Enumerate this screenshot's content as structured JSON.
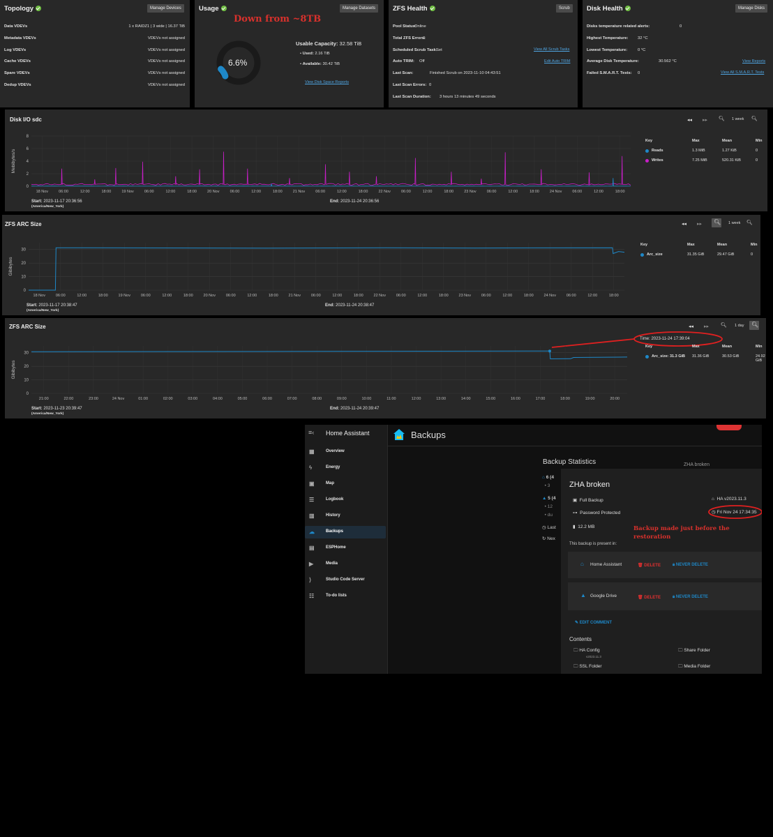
{
  "topology": {
    "title": "Topology",
    "button": "Manage Devices",
    "rows": [
      {
        "label": "Data VDEVs",
        "value": "1 x RAIDZ1 | 3 wide | 16.37 TiB"
      },
      {
        "label": "Metadata VDEVs",
        "value": "VDEVs not assigned"
      },
      {
        "label": "Log VDEVs",
        "value": "VDEVs not assigned"
      },
      {
        "label": "Cache VDEVs",
        "value": "VDEVs not assigned"
      },
      {
        "label": "Spare VDEVs",
        "value": "VDEVs not assigned"
      },
      {
        "label": "Dedup VDEVs",
        "value": "VDEVs not assigned"
      }
    ]
  },
  "usage": {
    "title": "Usage",
    "button": "Manage Datasets",
    "annotation": "Down from ~8TB",
    "percent_text": "6.6%",
    "percent": 0.066,
    "capacity_label": "Usable Capacity:",
    "capacity_value": "32.58 TiB",
    "used_label": "Used:",
    "used_value": "2.16 TiB",
    "available_label": "Available:",
    "available_value": "30.42 TiB",
    "link": "View Disk Space Reports"
  },
  "zfs_health": {
    "title": "ZFS Health",
    "button": "Scrub",
    "rows": [
      {
        "label": "Pool Status:",
        "value": "Online"
      },
      {
        "label": "Total ZFS Errors:",
        "value": "0"
      },
      {
        "label": "Scheduled Scrub Task:",
        "value": "Set"
      },
      {
        "label": "Auto TRIM:",
        "value": "Off"
      },
      {
        "label": "Last Scan:",
        "value": "Finished Scrub on 2023-11-10 04:43:51"
      },
      {
        "label": "Last Scan Errors:",
        "value": "0"
      },
      {
        "label": "Last Scan Duration:",
        "value": "3 hours 13 minutes 49 seconds"
      }
    ],
    "link_scrub": "View All Scrub Tasks",
    "link_trim": "Edit Auto TRIM"
  },
  "disk_health": {
    "title": "Disk Health",
    "button": "Manage Disks",
    "rows": [
      {
        "label": "Disks temperature related alerts:",
        "value": "0"
      },
      {
        "label": "Highest Temperature:",
        "value": "32 °C"
      },
      {
        "label": "Lowest Temperature:",
        "value": "0 °C"
      },
      {
        "label": "Average Disk Temperature:",
        "value": "30.562 °C"
      },
      {
        "label": "Failed S.M.A.R.T. Tests:",
        "value": "0"
      }
    ],
    "link_reports": "View Reports",
    "link_smart": "View All S.M.A.R.T. Tests"
  },
  "charts_ui": {
    "legend_key": "Key",
    "legend_max": "Max",
    "legend_mean": "Mean",
    "legend_min": "Min",
    "start_label": "Start:",
    "end_label": "End:",
    "tz": "(America/New_York)"
  },
  "disk_io": {
    "title": "Disk I/O sdc",
    "range": "1 week",
    "start": "2023-11-17 20:36:56",
    "end": "2023-11-24 20:36:56",
    "legend": [
      {
        "name": "Reads",
        "max": "1.3 MiB",
        "mean": "1.27 KiB",
        "min": "0",
        "color": "#1e88c8"
      },
      {
        "name": "Writes",
        "max": "7.25 MiB",
        "mean": "520.31 KiB",
        "min": "0",
        "color": "#c81ec8"
      }
    ]
  },
  "arc_week": {
    "title": "ZFS ARC Size",
    "range": "1 week",
    "start": "2023-11-17 20:38:47",
    "end": "2023-11-24 20:38:47",
    "legend": [
      {
        "name": "Arc_size",
        "max": "31.35 GiB",
        "mean": "29.47 GiB",
        "min": "0",
        "color": "#1e88c8"
      }
    ]
  },
  "arc_day": {
    "title": "ZFS ARC Size",
    "range": "1 day",
    "tooltip": "Time: 2023-11-24 17:39:04",
    "start": "2023-11-23 20:39:47",
    "end": "2023-11-24 20:39:47",
    "legend": [
      {
        "name": "Arc_size: 31.3 GiB",
        "max": "31.36 GiB",
        "mean": "30.53 GiB",
        "min": "24.92 GiB",
        "color": "#1e88c8"
      }
    ]
  },
  "chart_data": [
    {
      "type": "line",
      "title": "Disk I/O sdc",
      "ylabel": "Mebibytes/s",
      "ylim": [
        0,
        8
      ],
      "yticks": [
        0,
        2,
        4,
        6,
        8
      ],
      "x_ticks": [
        "18 Nov",
        "06:00",
        "12:00",
        "18:00",
        "19 Nov",
        "06:00",
        "12:00",
        "18:00",
        "20 Nov",
        "06:00",
        "12:00",
        "18:00",
        "21 Nov",
        "06:00",
        "12:00",
        "18:00",
        "22 Nov",
        "06:00",
        "12:00",
        "18:00",
        "23 Nov",
        "06:00",
        "12:00",
        "18:00",
        "24 Nov",
        "06:00",
        "12:00",
        "18:00"
      ],
      "grid": true,
      "series": [
        {
          "name": "Writes",
          "color": "#c81ec8",
          "baseline": 0.3,
          "spikes": [
            [
              0.05,
              2.8
            ],
            [
              0.105,
              1.1
            ],
            [
              0.14,
              2.9
            ],
            [
              0.185,
              3.9
            ],
            [
              0.24,
              1.6
            ],
            [
              0.28,
              2.7
            ],
            [
              0.32,
              5.5
            ],
            [
              0.36,
              2.8
            ],
            [
              0.43,
              1.3
            ],
            [
              0.49,
              3.5
            ],
            [
              0.53,
              2.3
            ],
            [
              0.575,
              1.6
            ],
            [
              0.64,
              4.5
            ],
            [
              0.7,
              2.3
            ],
            [
              0.75,
              1.2
            ],
            [
              0.79,
              5.4
            ],
            [
              0.85,
              2.7
            ],
            [
              0.93,
              2.2
            ],
            [
              0.985,
              4.8
            ]
          ]
        },
        {
          "name": "Reads",
          "color": "#1e88c8",
          "baseline": 0.02,
          "spikes": [
            [
              0.4,
              0.4
            ],
            [
              0.97,
              1.3
            ]
          ]
        }
      ]
    },
    {
      "type": "line",
      "title": "ZFS ARC Size",
      "ylabel": "Gibibytes",
      "ylim": [
        0,
        35
      ],
      "yticks": [
        0,
        10,
        20,
        30
      ],
      "x_ticks": [
        "18 Nov",
        "06:00",
        "12:00",
        "18:00",
        "19 Nov",
        "06:00",
        "12:00",
        "18:00",
        "20 Nov",
        "06:00",
        "12:00",
        "18:00",
        "21 Nov",
        "06:00",
        "12:00",
        "18:00",
        "22 Nov",
        "06:00",
        "12:00",
        "18:00",
        "23 Nov",
        "06:00",
        "12:00",
        "18:00",
        "24 Nov",
        "06:00",
        "12:00",
        "18:00"
      ],
      "grid": true,
      "series": [
        {
          "name": "Arc_size",
          "color": "#1e88c8",
          "points": [
            [
              0,
              0
            ],
            [
              0.045,
              0
            ],
            [
              0.046,
              31.3
            ],
            [
              0.4,
              31.0
            ],
            [
              0.6,
              31.3
            ],
            [
              0.75,
              31.1
            ],
            [
              0.98,
              31.3
            ],
            [
              0.981,
              27
            ],
            [
              0.99,
              28.5
            ],
            [
              1,
              28
            ]
          ]
        }
      ]
    },
    {
      "type": "line",
      "title": "ZFS ARC Size",
      "ylabel": "Gibibytes",
      "ylim": [
        0,
        35
      ],
      "yticks": [
        0,
        10,
        20,
        30
      ],
      "x_ticks": [
        "21:00",
        "22:00",
        "23:00",
        "24 Nov",
        "01:00",
        "02:00",
        "03:00",
        "04:00",
        "05:00",
        "06:00",
        "07:00",
        "08:00",
        "09:00",
        "10:00",
        "11:00",
        "12:00",
        "13:00",
        "14:00",
        "15:00",
        "16:00",
        "17:00",
        "18:00",
        "19:00",
        "20:00"
      ],
      "grid": true,
      "series": [
        {
          "name": "Arc_size",
          "color": "#1e88c8",
          "points": [
            [
              0,
              30.8
            ],
            [
              0.45,
              31.0
            ],
            [
              0.87,
              31.3
            ],
            [
              0.871,
              25.5
            ],
            [
              0.905,
              25.6
            ],
            [
              0.91,
              26.5
            ],
            [
              1,
              26.8
            ]
          ]
        }
      ]
    }
  ],
  "ha": {
    "app_title": "Home Assistant",
    "page_title": "Backups",
    "nav": [
      {
        "label": "Overview",
        "icon": "grid"
      },
      {
        "label": "Energy",
        "icon": "bolt"
      },
      {
        "label": "Map",
        "icon": "person"
      },
      {
        "label": "Logbook",
        "icon": "list"
      },
      {
        "label": "History",
        "icon": "chart"
      },
      {
        "label": "Backups",
        "icon": "cloud"
      },
      {
        "label": "ESPHome",
        "icon": "chip"
      },
      {
        "label": "Media",
        "icon": "play"
      },
      {
        "label": "Studio Code Server",
        "icon": "code"
      },
      {
        "label": "To-do lists",
        "icon": "todo"
      }
    ],
    "stats_title": "Backup Statistics",
    "bg_list_title": "ZHA broken",
    "bg_items": [
      "6 (4",
      "• 3",
      "5 (4",
      "• 12",
      "• du",
      "Last",
      "Nex"
    ],
    "dialog": {
      "title": "ZHA broken",
      "type": "Full Backup",
      "version": "HA v2023.11.3",
      "protected": "Password Protected",
      "date": "Fri Nov 24 17:34:35",
      "size": "12.2 MB",
      "present_in": "This backup is present in:",
      "locations": [
        {
          "name": "Home Assistant",
          "delete": "DELETE",
          "never": "NEVER DELETE"
        },
        {
          "name": "Google Drive",
          "delete": "DELETE",
          "never": "NEVER DELETE"
        }
      ],
      "edit_comment": "EDIT COMMENT",
      "contents_title": "Contents",
      "contents": [
        {
          "name": "HA Config",
          "sub": "v2023.11.3"
        },
        {
          "name": "Share Folder",
          "sub": ""
        },
        {
          "name": "SSL Folder",
          "sub": ""
        },
        {
          "name": "Media Folder",
          "sub": ""
        }
      ]
    },
    "annotation": "Backup made just before the restoration"
  }
}
